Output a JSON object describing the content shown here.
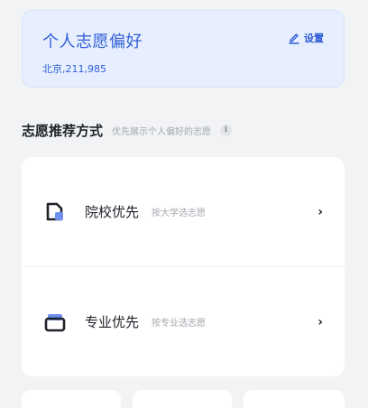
{
  "preferences": {
    "title": "个人志愿偏好",
    "subtitle": "北京,211,985",
    "settings_label": "设置"
  },
  "recommend": {
    "title": "志愿推荐方式",
    "hint": "优先展示个人偏好的志愿",
    "info_icon": "i",
    "options": [
      {
        "label": "院校优先",
        "hint": "按大学选志愿",
        "icon": "school-icon"
      },
      {
        "label": "专业优先",
        "hint": "按专业选志愿",
        "icon": "major-icon"
      }
    ],
    "chevron": "›"
  },
  "colors": {
    "accent": "#2f5dd6",
    "card_bg": "#e7efff",
    "icon_dark": "#1f2329",
    "icon_accent": "#6e8ff0"
  }
}
